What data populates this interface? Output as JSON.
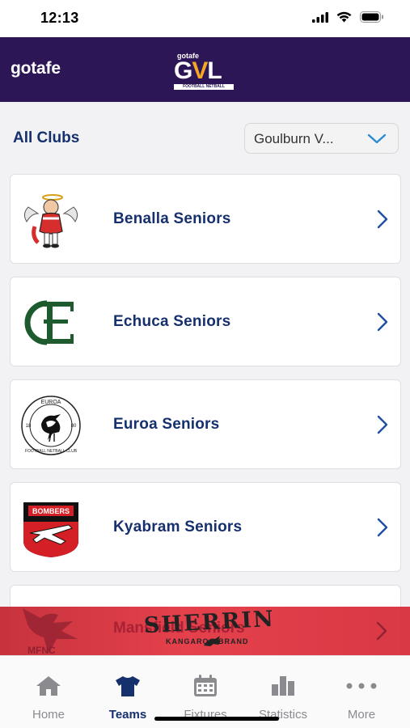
{
  "status_bar": {
    "time": "12:13",
    "icons": [
      "signal-icon",
      "wifi-icon",
      "battery-icon"
    ]
  },
  "header": {
    "brand": "gotafe",
    "logo_small": "gotafe",
    "logo_main_left": "G",
    "logo_main_accent": "V",
    "logo_main_right": "L",
    "logo_sub": "FOOTBALL NETBALL",
    "background": "#2d1656"
  },
  "page": {
    "title": "All Clubs",
    "league_select": {
      "value": "Goulburn V..."
    }
  },
  "clubs": [
    {
      "name": "Benalla Seniors",
      "logo": "benalla-saints-logo"
    },
    {
      "name": "Echuca Seniors",
      "logo": "echuca-logo"
    },
    {
      "name": "Euroa Seniors",
      "logo": "euroa-magpies-logo",
      "logo_text_top": "EUROA",
      "logo_text_left": "18",
      "logo_text_right": "80",
      "logo_text_bottom": "FOOTBALL NETBALL CLUB"
    },
    {
      "name": "Kyabram Seniors",
      "logo": "kyabram-bombers-logo",
      "logo_text": "BOMBERS"
    },
    {
      "name": "Mansfield Seniors",
      "logo": "mansfield-eagles-logo",
      "logo_text": "MFNC"
    }
  ],
  "banner": {
    "brand": "SHERRIN",
    "tagline": "KANGAROO BRAND",
    "background": "#d8323d"
  },
  "tabs": [
    {
      "label": "Home",
      "icon": "home-icon",
      "active": false
    },
    {
      "label": "Teams",
      "icon": "jersey-icon",
      "active": true
    },
    {
      "label": "Fixtures",
      "icon": "calendar-icon",
      "active": false
    },
    {
      "label": "Statistics",
      "icon": "bar-chart-icon",
      "active": false
    },
    {
      "label": "More",
      "icon": "more-dots-icon",
      "active": false
    }
  ],
  "colors": {
    "accent": "#16306e",
    "header": "#2d1656",
    "chevron": "#1f4fa0",
    "tab_inactive": "#8a8a8f"
  }
}
